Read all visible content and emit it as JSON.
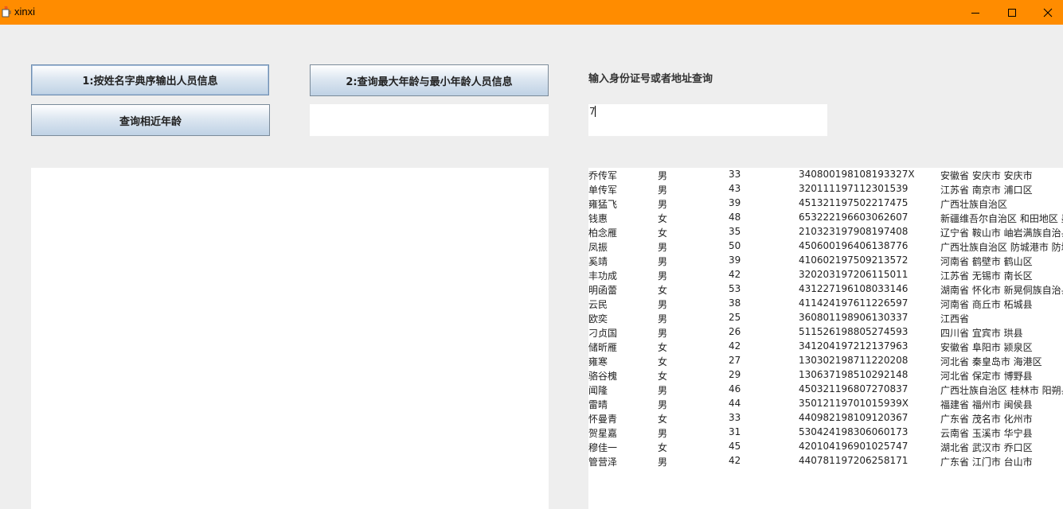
{
  "window": {
    "title": "xinxi",
    "controls": [
      "minimize-icon",
      "maximize-icon",
      "close-icon"
    ]
  },
  "buttons": {
    "sort_by_name": "1:按姓名字典序输出人员信息",
    "max_min_age": "2:查询最大年龄与最小年龄人员信息",
    "similar_age": "查询相近年龄"
  },
  "age_input": {
    "value": ""
  },
  "query": {
    "label": "输入身份证号或者地址查询",
    "value": "7"
  },
  "results": [
    {
      "name": "乔传军",
      "sex": "男",
      "age": "33",
      "id": "340800198108193327X",
      "addr": "安徽省 安庆市 安庆市"
    },
    {
      "name": "单传军",
      "sex": "男",
      "age": "43",
      "id": "320111197112301539",
      "addr": "江苏省 南京市 浦口区"
    },
    {
      "name": "雍猛飞",
      "sex": "男",
      "age": "39",
      "id": "451321197502217475",
      "addr": "广西壮族自治区"
    },
    {
      "name": "钱惠",
      "sex": "女",
      "age": "48",
      "id": "653222196603062607",
      "addr": "新疆维吾尔自治区 和田地区 墨"
    },
    {
      "name": "柏念雁",
      "sex": "女",
      "age": "35",
      "id": "210323197908197408",
      "addr": "辽宁省 鞍山市 岫岩满族自治县"
    },
    {
      "name": "凤振",
      "sex": "男",
      "age": "50",
      "id": "450600196406138776",
      "addr": "广西壮族自治区 防城港市 防城"
    },
    {
      "name": "奚靖",
      "sex": "男",
      "age": "39",
      "id": "410602197509213572",
      "addr": "河南省 鹤壁市 鹤山区"
    },
    {
      "name": "丰功成",
      "sex": "男",
      "age": "42",
      "id": "320203197206115011",
      "addr": "江苏省 无锡市 南长区"
    },
    {
      "name": "明函蕾",
      "sex": "女",
      "age": "53",
      "id": "431227196108033146",
      "addr": "湖南省 怀化市 新晃侗族自治县"
    },
    {
      "name": "云民",
      "sex": "男",
      "age": "38",
      "id": "411424197611226597",
      "addr": "河南省 商丘市 柘城县"
    },
    {
      "name": "欧奕",
      "sex": "男",
      "age": "25",
      "id": "360801198906130337",
      "addr": "江西省"
    },
    {
      "name": "刁贞国",
      "sex": "男",
      "age": "26",
      "id": "511526198805274593",
      "addr": "四川省 宜宾市 珙县"
    },
    {
      "name": "储昕雁",
      "sex": "女",
      "age": "42",
      "id": "341204197212137963",
      "addr": "安徽省 阜阳市 颍泉区"
    },
    {
      "name": "雍寒",
      "sex": "女",
      "age": "27",
      "id": "130302198711220208",
      "addr": "河北省 秦皇岛市 海港区"
    },
    {
      "name": "骆谷槐",
      "sex": "女",
      "age": "29",
      "id": "130637198510292148",
      "addr": "河北省 保定市 博野县"
    },
    {
      "name": "闻隆",
      "sex": "男",
      "age": "46",
      "id": "450321196807270837",
      "addr": "广西壮族自治区 桂林市 阳朔县"
    },
    {
      "name": "雷晴",
      "sex": "男",
      "age": "44",
      "id": "35012119701015939X",
      "addr": "福建省 福州市 闽侯县"
    },
    {
      "name": "怀曼青",
      "sex": "女",
      "age": "33",
      "id": "440982198109120367",
      "addr": "广东省 茂名市 化州市"
    },
    {
      "name": "贺星嘉",
      "sex": "男",
      "age": "31",
      "id": "530424198306060173",
      "addr": "云南省 玉溪市 华宁县"
    },
    {
      "name": "穆佳一",
      "sex": "女",
      "age": "45",
      "id": "420104196901025747",
      "addr": "湖北省 武汉市 乔口区"
    },
    {
      "name": "管营泽",
      "sex": "男",
      "age": "42",
      "id": "440781197206258171",
      "addr": "广东省 江门市 台山市"
    }
  ]
}
